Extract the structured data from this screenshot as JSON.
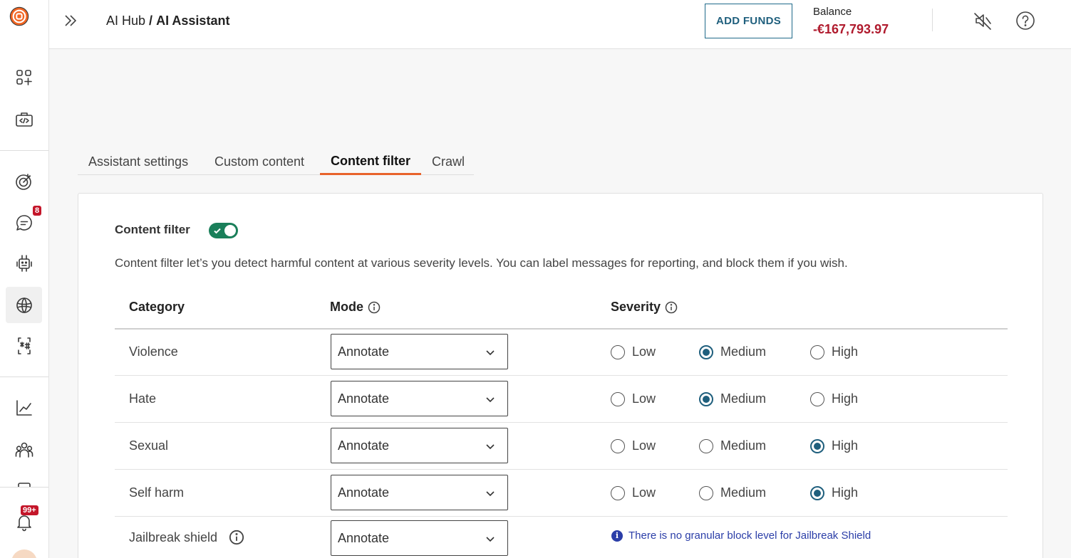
{
  "header": {
    "breadcrumb_parent": "AI Hub",
    "breadcrumb_sep": "/",
    "breadcrumb_current": "AI Assistant",
    "add_funds_label": "ADD FUNDS",
    "balance_label": "Balance",
    "balance_value": "-€167,793.97"
  },
  "sidebar": {
    "conversations_badge": "8",
    "notifications_badge": "99+"
  },
  "tabs": [
    {
      "label": "Assistant settings",
      "active": false
    },
    {
      "label": "Custom content",
      "active": false
    },
    {
      "label": "Content filter",
      "active": true
    },
    {
      "label": "Crawl",
      "active": false
    }
  ],
  "content_filter": {
    "title": "Content filter",
    "enabled": true,
    "description": "Content filter let’s you detect harmful content at various severity levels. You can label messages for reporting, and block them if you wish.",
    "columns": {
      "category": "Category",
      "mode": "Mode",
      "severity": "Severity"
    },
    "severity_options": [
      "Low",
      "Medium",
      "High"
    ],
    "rows": [
      {
        "category": "Violence",
        "mode": "Annotate",
        "severity": "Medium"
      },
      {
        "category": "Hate",
        "mode": "Annotate",
        "severity": "Medium"
      },
      {
        "category": "Sexual",
        "mode": "Annotate",
        "severity": "High"
      },
      {
        "category": "Self harm",
        "mode": "Annotate",
        "severity": "High"
      },
      {
        "category": "Jailbreak shield",
        "mode": "Annotate",
        "note": "There is no granular block level for Jailbreak Shield"
      }
    ]
  },
  "colors": {
    "accent": "#e8632b",
    "primary": "#1f5f7d",
    "danger": "#b01b2e",
    "toggle": "#1a7f5a"
  }
}
